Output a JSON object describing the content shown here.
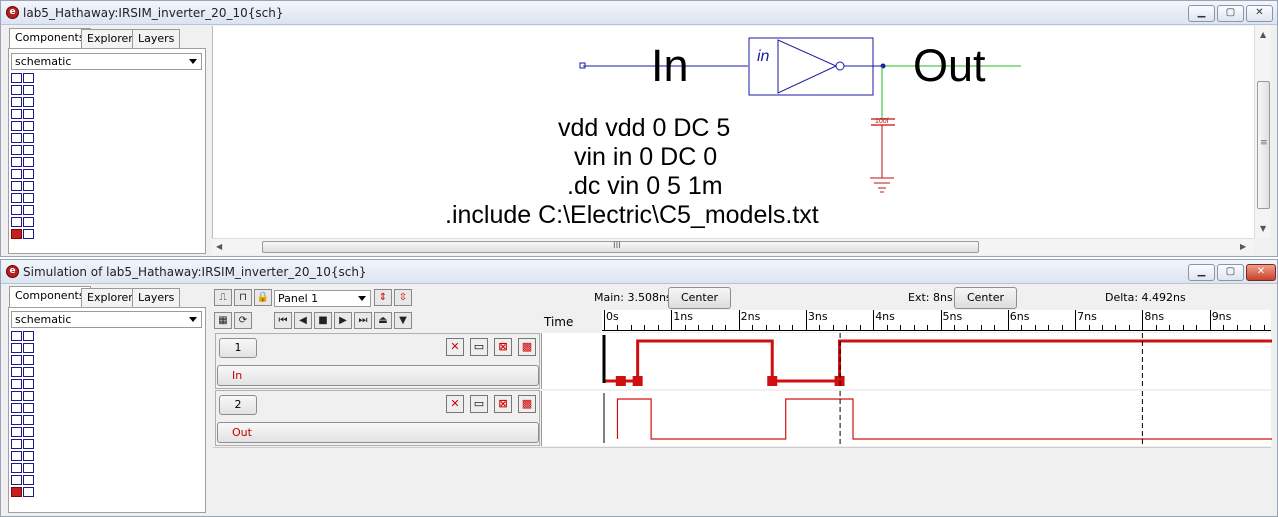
{
  "schematic_window": {
    "title": "lab5_Hathaway:IRSIM_inverter_20_10{sch}",
    "tabs": [
      "Components",
      "Explorer",
      "Layers"
    ],
    "library": "schematic",
    "labels": {
      "in": "In",
      "out": "Out",
      "instance": "in",
      "cap": "100f"
    },
    "spice": [
      "vdd vdd 0 DC 5",
      "vin in 0 DC 0",
      ".dc vin 0 5 1m",
      ".include C:\\Electric\\C5_models.txt"
    ],
    "hscroll_grip": "III",
    "vscroll_grip": "≡"
  },
  "sim_window": {
    "title": "Simulation of lab5_Hathaway:IRSIM_inverter_20_10{sch}",
    "tabs": [
      "Components",
      "Explorer",
      "Layers"
    ],
    "library": "schematic",
    "panel_select": "Panel 1",
    "main_label": "Main: 3.508ns",
    "center_label": "Center",
    "ext_label": "Ext: 8ns",
    "delta_label": "Delta: 4.492ns",
    "time_label": "Time",
    "ticks": [
      "0s",
      "1ns",
      "2ns",
      "3ns",
      "4ns",
      "5ns",
      "6ns",
      "7ns",
      "8ns",
      "9ns"
    ],
    "signals": [
      {
        "number": "1",
        "name": "In"
      },
      {
        "number": "2",
        "name": "Out"
      }
    ]
  },
  "waveforms": {
    "main_cursor_ns": 3.508,
    "ext_cursor_ns": 8,
    "in_transitions_ns": [
      0.0,
      0.25,
      0.5,
      2.5,
      3.5
    ],
    "out_transitions_ns": [
      0.2,
      0.7,
      2.7,
      3.7
    ]
  },
  "colors": {
    "wire": "#1a1aa0",
    "green_wire": "#22bb22",
    "red": "#d01010",
    "cap": "#c01010"
  }
}
